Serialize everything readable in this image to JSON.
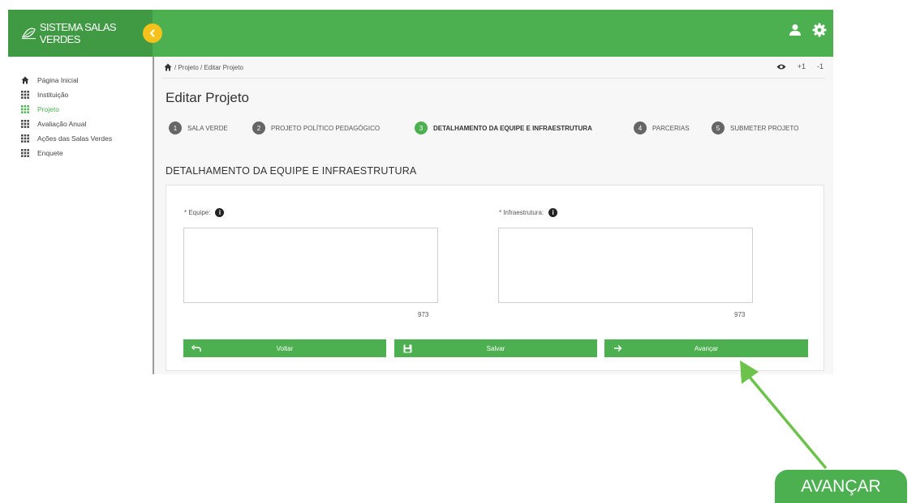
{
  "brand": {
    "name": "SISTEMA SALAS VERDES"
  },
  "colors": {
    "primary": "#4caf50",
    "primary_dark": "#3f9a43",
    "toggle": "#f5c21b",
    "step_inactive": "#666666"
  },
  "topbar": {
    "icons": [
      "user-icon",
      "gear-icon"
    ]
  },
  "sidebar": {
    "items": [
      {
        "label": "Página Inicial",
        "icon": "home-icon",
        "active": false
      },
      {
        "label": "Instituição",
        "icon": "grid-icon",
        "active": false
      },
      {
        "label": "Projeto",
        "icon": "grid-icon",
        "active": true
      },
      {
        "label": "Avaliação Anual",
        "icon": "grid-icon",
        "active": false
      },
      {
        "label": "Ações das Salas Verdes",
        "icon": "grid-icon",
        "active": false
      },
      {
        "label": "Enquete",
        "icon": "grid-icon",
        "active": false
      }
    ]
  },
  "breadcrumb": {
    "text": "/ Projeto / Editar Projeto"
  },
  "zoom": {
    "plus": "+1",
    "minus": "-1"
  },
  "page": {
    "title": "Editar Projeto"
  },
  "steps": [
    {
      "num": "1",
      "label": "SALA VERDE"
    },
    {
      "num": "2",
      "label": "PROJETO POLÍTICO PEDAGÓGICO"
    },
    {
      "num": "3",
      "label": "DETALHAMENTO DA EQUIPE E INFRAESTRUTURA",
      "current": true
    },
    {
      "num": "4",
      "label": "PARCERIAS"
    },
    {
      "num": "5",
      "label": "SUBMETER PROJETO"
    }
  ],
  "section": {
    "title": "DETALHAMENTO DA EQUIPE E INFRAESTRUTURA"
  },
  "form": {
    "equipe": {
      "label": "* Equipe:",
      "counter": "973",
      "value": ""
    },
    "infraestrutura": {
      "label": "* Infraestrutura:",
      "counter": "973",
      "value": ""
    }
  },
  "buttons": {
    "back": "Voltar",
    "save": "Salvar",
    "next": "Avançar"
  },
  "annotation": {
    "label": "AVANÇAR"
  }
}
